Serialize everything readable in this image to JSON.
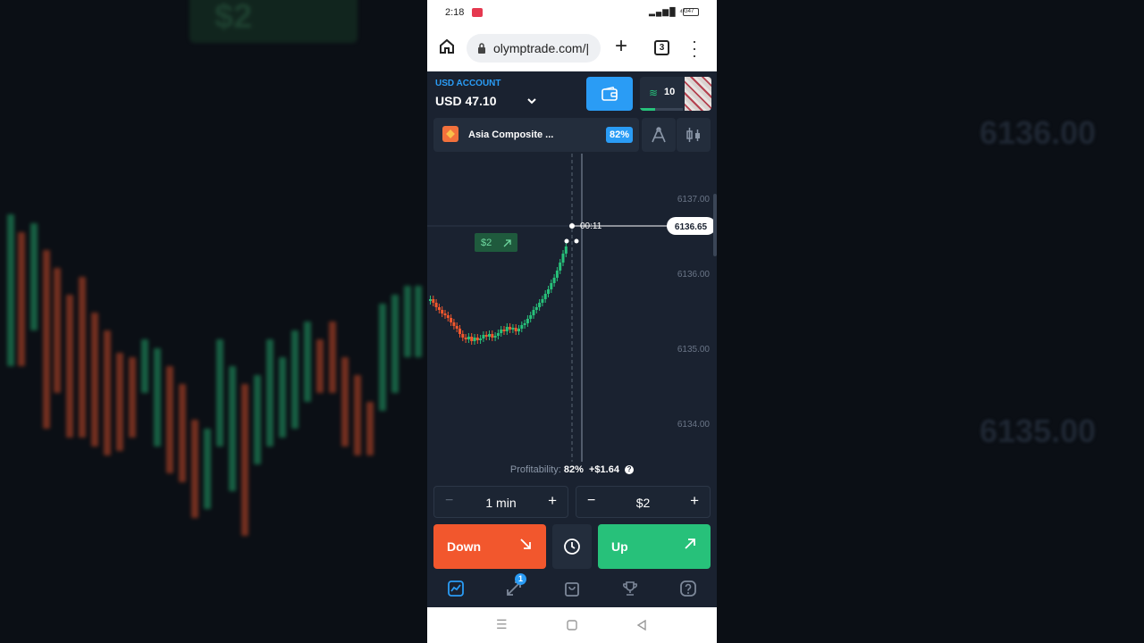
{
  "status_bar": {
    "time": "2:18",
    "signal": "⁴ᴳ",
    "battery": "47"
  },
  "browser": {
    "url": "olymptrade.com/|",
    "tab_count": "3"
  },
  "account": {
    "label": "USD ACCOUNT",
    "balance": "USD 47.10"
  },
  "rank": {
    "value": "10",
    "progress_fraction": 0.35
  },
  "asset": {
    "name": "Asia Composite ...",
    "payout": "82%"
  },
  "chart": {
    "price_levels": [
      "6137.00",
      "6136.00",
      "6135.00",
      "6134.00"
    ],
    "current_price": "6136.65",
    "timer": "00:11",
    "trade_marker": "$2",
    "colors": {
      "up": "#27c17a",
      "down": "#f2572d",
      "background": "#1a2230",
      "accent": "#2a9cf5"
    }
  },
  "profitability": {
    "label": "Profitability:",
    "percent": "82%",
    "amount": "+$1.64",
    "help": "?"
  },
  "duration": {
    "value": "1 min",
    "minus": "−",
    "plus": "+"
  },
  "amount": {
    "value": "$2",
    "minus": "−",
    "plus": "+"
  },
  "buttons": {
    "down": "Down",
    "up": "Up"
  },
  "nav": {
    "trades_badge": "1"
  },
  "icons": [
    "home-icon",
    "lock-icon",
    "plus-icon",
    "tabs-icon",
    "more-vert-icon",
    "wallet-icon",
    "rank-icon",
    "drawing-tools-icon",
    "chart-type-icon",
    "clock-icon",
    "chart-icon",
    "trades-icon",
    "market-icon",
    "trophy-icon",
    "help-icon"
  ]
}
